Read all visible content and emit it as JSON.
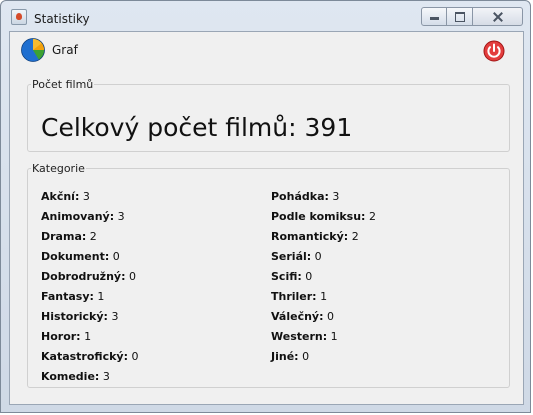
{
  "window": {
    "title": "Statistiky"
  },
  "toolbar": {
    "graph_label": "Graf"
  },
  "count_panel": {
    "legend": "Počet filmů",
    "text": "Celkový počet filmů: 391"
  },
  "categories_panel": {
    "legend": "Kategorie",
    "left": [
      {
        "label": "Akční:",
        "value": "3"
      },
      {
        "label": "Animovaný:",
        "value": "3"
      },
      {
        "label": "Drama:",
        "value": "2"
      },
      {
        "label": "Dokument:",
        "value": "0"
      },
      {
        "label": "Dobrodružný:",
        "value": "0"
      },
      {
        "label": "Fantasy:",
        "value": "1"
      },
      {
        "label": "Historický:",
        "value": "3"
      },
      {
        "label": "Horor:",
        "value": "1"
      },
      {
        "label": "Katastrofický:",
        "value": "0"
      },
      {
        "label": "Komedie:",
        "value": "3"
      }
    ],
    "right": [
      {
        "label": "Pohádka:",
        "value": "3"
      },
      {
        "label": "Podle komiksu:",
        "value": "2"
      },
      {
        "label": "Romantický:",
        "value": "2"
      },
      {
        "label": "Seriál:",
        "value": "0"
      },
      {
        "label": "Scifi:",
        "value": "0"
      },
      {
        "label": "Thriler:",
        "value": "1"
      },
      {
        "label": "Válečný:",
        "value": " 0"
      },
      {
        "label": "Western:",
        "value": "1"
      },
      {
        "label": "Jiné:",
        "value": "0"
      }
    ]
  },
  "icons": {
    "graph": "pie-chart-icon",
    "power": "power-icon",
    "app": "java-app-icon"
  },
  "colors": {
    "power_red": "#d9262a",
    "pie_blue": "#1f6fd0",
    "pie_orange": "#f2a10c",
    "pie_green": "#3da232"
  }
}
